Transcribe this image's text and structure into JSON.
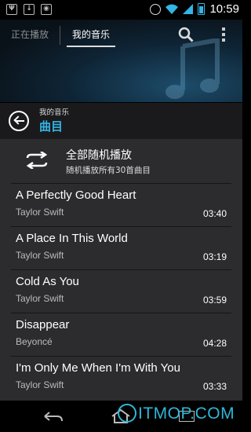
{
  "status_bar": {
    "time": "10:59",
    "icons": [
      "usb-icon",
      "download-icon",
      "android-icon",
      "alarm-icon",
      "wifi-icon",
      "signal-icon",
      "battery-icon"
    ]
  },
  "tabs": {
    "now_playing": "正在播放",
    "my_music": "我的音乐"
  },
  "title_bar": {
    "subtitle": "我的音乐",
    "title": "曲目"
  },
  "shuffle": {
    "title": "全部随机播放",
    "subtitle": "随机播放所有30首曲目"
  },
  "songs": [
    {
      "title": "A Perfectly Good Heart",
      "artist": "Taylor Swift",
      "duration": "03:40"
    },
    {
      "title": "A Place In This World",
      "artist": "Taylor Swift",
      "duration": "03:19"
    },
    {
      "title": "Cold As You",
      "artist": "Taylor Swift",
      "duration": "03:59"
    },
    {
      "title": "Disappear",
      "artist": "Beyoncé",
      "duration": "04:28"
    },
    {
      "title": "I'm Only Me When I'm With You",
      "artist": "Taylor Swift",
      "duration": "03:33"
    }
  ],
  "watermark": "ITMOP.COM",
  "colors": {
    "accent": "#33b5e5",
    "list_bg": "#2c2c2e",
    "watermark": "#2eb8d8"
  }
}
